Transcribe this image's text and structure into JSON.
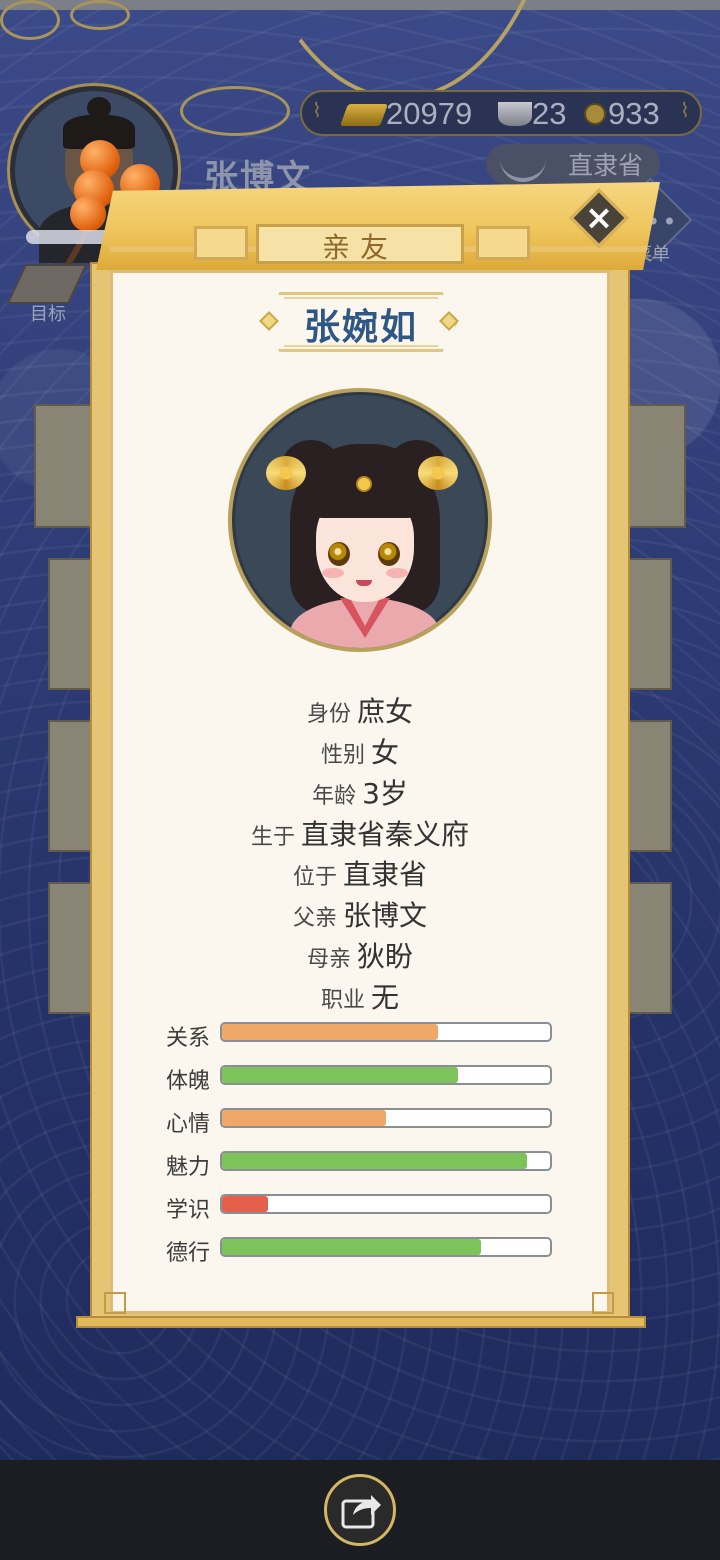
{
  "header": {
    "player_name": "张博文",
    "resources": {
      "gold": "20979",
      "silver": "23",
      "coins": "933"
    },
    "location": "直隶省",
    "menu_label": "菜单",
    "goal_label": "目标"
  },
  "dialog": {
    "title": "亲友",
    "close_icon": "close-icon",
    "character": {
      "name": "张婉如",
      "info": [
        {
          "label": "身份",
          "value": "庶女"
        },
        {
          "label": "性别",
          "value": "女"
        },
        {
          "label": "年龄",
          "value": "3岁"
        },
        {
          "label": "生于",
          "value": "直隶省秦义府"
        },
        {
          "label": "位于",
          "value": "直隶省"
        },
        {
          "label": "父亲",
          "value": "张博文"
        },
        {
          "label": "母亲",
          "value": "狄盼"
        },
        {
          "label": "职业",
          "value": "无"
        }
      ],
      "stats": [
        {
          "label": "关系",
          "value": 0.66,
          "color": "#f0a868"
        },
        {
          "label": "体魄",
          "value": 0.72,
          "color": "#7cc45a"
        },
        {
          "label": "心情",
          "value": 0.5,
          "color": "#f0a868"
        },
        {
          "label": "魅力",
          "value": 0.93,
          "color": "#7cc45a"
        },
        {
          "label": "学识",
          "value": 0.14,
          "color": "#e5604a"
        },
        {
          "label": "德行",
          "value": 0.79,
          "color": "#7cc45a"
        }
      ]
    }
  },
  "footer": {
    "share_icon": "share-icon"
  }
}
